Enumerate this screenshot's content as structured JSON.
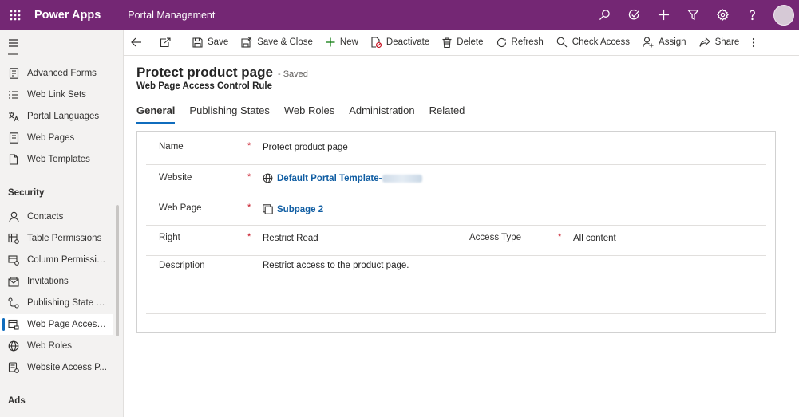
{
  "app": {
    "title": "Power Apps",
    "environment": "Portal Management"
  },
  "topbar_icons": [
    "search-icon",
    "task-check-icon",
    "plus-icon",
    "filter-icon",
    "settings-icon",
    "help-icon"
  ],
  "sidebar": {
    "items_top": [
      {
        "label": "Advanced Forms",
        "icon": "document-icon"
      },
      {
        "label": "Web Link Sets",
        "icon": "list-icon"
      },
      {
        "label": "Portal Languages",
        "icon": "language-icon"
      },
      {
        "label": "Web Pages",
        "icon": "page-icon"
      },
      {
        "label": "Web Templates",
        "icon": "file-icon"
      }
    ],
    "security_heading": "Security",
    "items_security": [
      {
        "label": "Contacts",
        "icon": "person-icon"
      },
      {
        "label": "Table Permissions",
        "icon": "table-permission-icon"
      },
      {
        "label": "Column Permissio...",
        "icon": "column-permission-icon"
      },
      {
        "label": "Invitations",
        "icon": "invitation-icon"
      },
      {
        "label": "Publishing State T...",
        "icon": "flow-icon"
      },
      {
        "label": "Web Page Access ...",
        "icon": "page-access-icon",
        "active": true
      },
      {
        "label": "Web Roles",
        "icon": "globe-icon"
      },
      {
        "label": "Website Access P...",
        "icon": "website-access-icon"
      }
    ],
    "ads_heading": "Ads"
  },
  "commands": {
    "save": "Save",
    "save_close": "Save & Close",
    "new": "New",
    "deactivate": "Deactivate",
    "delete": "Delete",
    "refresh": "Refresh",
    "check_access": "Check Access",
    "assign": "Assign",
    "share": "Share"
  },
  "record": {
    "title": "Protect product page",
    "status": "- Saved",
    "entity": "Web Page Access Control Rule"
  },
  "tabs": [
    {
      "label": "General",
      "active": true
    },
    {
      "label": "Publishing States"
    },
    {
      "label": "Web Roles"
    },
    {
      "label": "Administration"
    },
    {
      "label": "Related"
    }
  ],
  "form": {
    "required_marker": "*",
    "name": {
      "label": "Name",
      "value": "Protect product page"
    },
    "website": {
      "label": "Website",
      "value": "Default Portal Template-"
    },
    "web_page": {
      "label": "Web Page",
      "value": "Subpage 2"
    },
    "right": {
      "label": "Right",
      "value": "Restrict Read"
    },
    "access_type": {
      "label": "Access Type",
      "value": "All content"
    },
    "description": {
      "label": "Description",
      "value": "Restrict access to the product page."
    }
  },
  "colors": {
    "brand": "#742774",
    "accent": "#0f6cbd",
    "link": "#115ea3",
    "required": "#c50f1f"
  }
}
